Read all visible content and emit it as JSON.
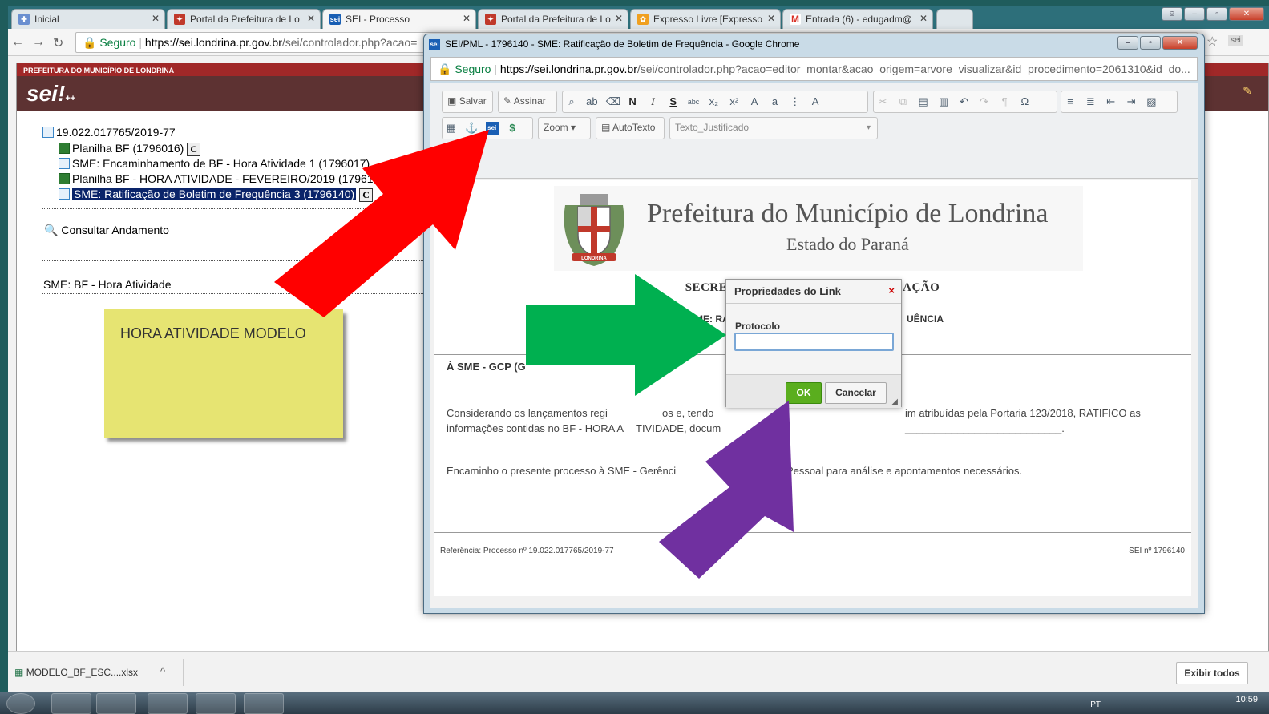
{
  "browser": {
    "tabs": [
      {
        "label": "Inicial",
        "icon": "puzzle-icon",
        "color": "#6a8fd0"
      },
      {
        "label": "Portal da Prefeitura de Lo",
        "icon": "crest-icon",
        "color": "#c0392b"
      },
      {
        "label": "SEI - Processo",
        "icon": "sei-icon",
        "color": "#1a5fb4"
      },
      {
        "label": "Portal da Prefeitura de Lo",
        "icon": "crest-icon",
        "color": "#c0392b"
      },
      {
        "label": "Expresso Livre [Expresso",
        "icon": "expresso-icon",
        "color": "#f0a020"
      },
      {
        "label": "Entrada (6) - edugadm@",
        "icon": "gmail-icon",
        "color": "#d93025"
      }
    ],
    "address": {
      "secure_label": "Seguro",
      "url_host": "https://sei.londrina.pr.gov.br",
      "url_rest": "/sei/controlador.php?acao="
    }
  },
  "sei": {
    "org_name": "PREFEITURA DO MUNICÍPIO DE LONDRINA",
    "logo_text": "sei!",
    "logo_suffix": "++",
    "tree": {
      "root": "19.022.017765/2019-77",
      "items": [
        {
          "label": "Planilha BF (1796016)",
          "type": "xls",
          "badge": "C"
        },
        {
          "label": "SME: Encaminhamento de BF - Hora Atividade 1 (1796017)",
          "type": "doc",
          "badge": ""
        },
        {
          "label": "Planilha BF - HORA ATIVIDADE - FEVEREIRO/2019 (17961",
          "type": "xls",
          "badge": ""
        },
        {
          "label": "SME: Ratificação de Boletim de Frequência 3 (1796140)",
          "type": "doc",
          "badge": "C",
          "selected": true
        }
      ]
    },
    "consultar": "Consultar Andamento",
    "marker": "SME: BF - Hora Atividade",
    "sticky_note": "HORA ATIVIDADE MODELO"
  },
  "popup": {
    "title": "SEI/PML - 1796140 - SME: Ratificação de Boletim de Frequência - Google Chrome",
    "secure_label": "Seguro",
    "url_host": "https://sei.londrina.pr.gov.br",
    "url_rest": "/sei/controlador.php?acao=editor_montar&acao_origem=arvore_visualizar&id_procedimento=2061310&id_do...",
    "toolbar": {
      "save": "Salvar",
      "sign": "Assinar",
      "bold": "N",
      "italic": "I",
      "underline": "S",
      "zoom": "Zoom",
      "autotext": "AutoTexto",
      "style": "Texto_Justificado"
    },
    "doc": {
      "heading": "Prefeitura do Município de Londrina",
      "subheading": "Estado do Paraná",
      "crest_label": "LONDRINA",
      "department": "SECRETARIA MUNICIPAL DE EDUCAÇÃO",
      "title_left": "SME: RA",
      "title_right": "UÊNCIA",
      "to": "À SME - GCP (G",
      "p1_a": "Considerando os lançamentos regi",
      "p1_b": "os e, tendo",
      "p1_c": "im atribuídas pela Portaria 123/2018, RATIFICO as",
      "p1_d": "informações contidas no BF - HORA A",
      "p1_e": "TIVIDADE, docum",
      "p1_f": "___________________________.",
      "p2_a": "Encaminho o presente processo à SME - Gerênci",
      "p2_b": "Pessoal para análise e apontamentos necessários.",
      "ref_left": "Referência: Processo nº 19.022.017765/2019-77",
      "ref_right": "SEI nº 1796140"
    }
  },
  "dialog": {
    "title": "Propriedades do Link",
    "close": "×",
    "field_label": "Protocolo",
    "field_value": "",
    "ok": "OK",
    "cancel": "Cancelar"
  },
  "downloads": {
    "file": "MODELO_BF_ESC....xlsx",
    "show_all": "Exibir todos"
  },
  "taskbar": {
    "lang": "PT",
    "time": "10:59"
  },
  "colors": {
    "arrow_red": "#ff0000",
    "arrow_green": "#00b050",
    "arrow_purple": "#7030a0"
  }
}
